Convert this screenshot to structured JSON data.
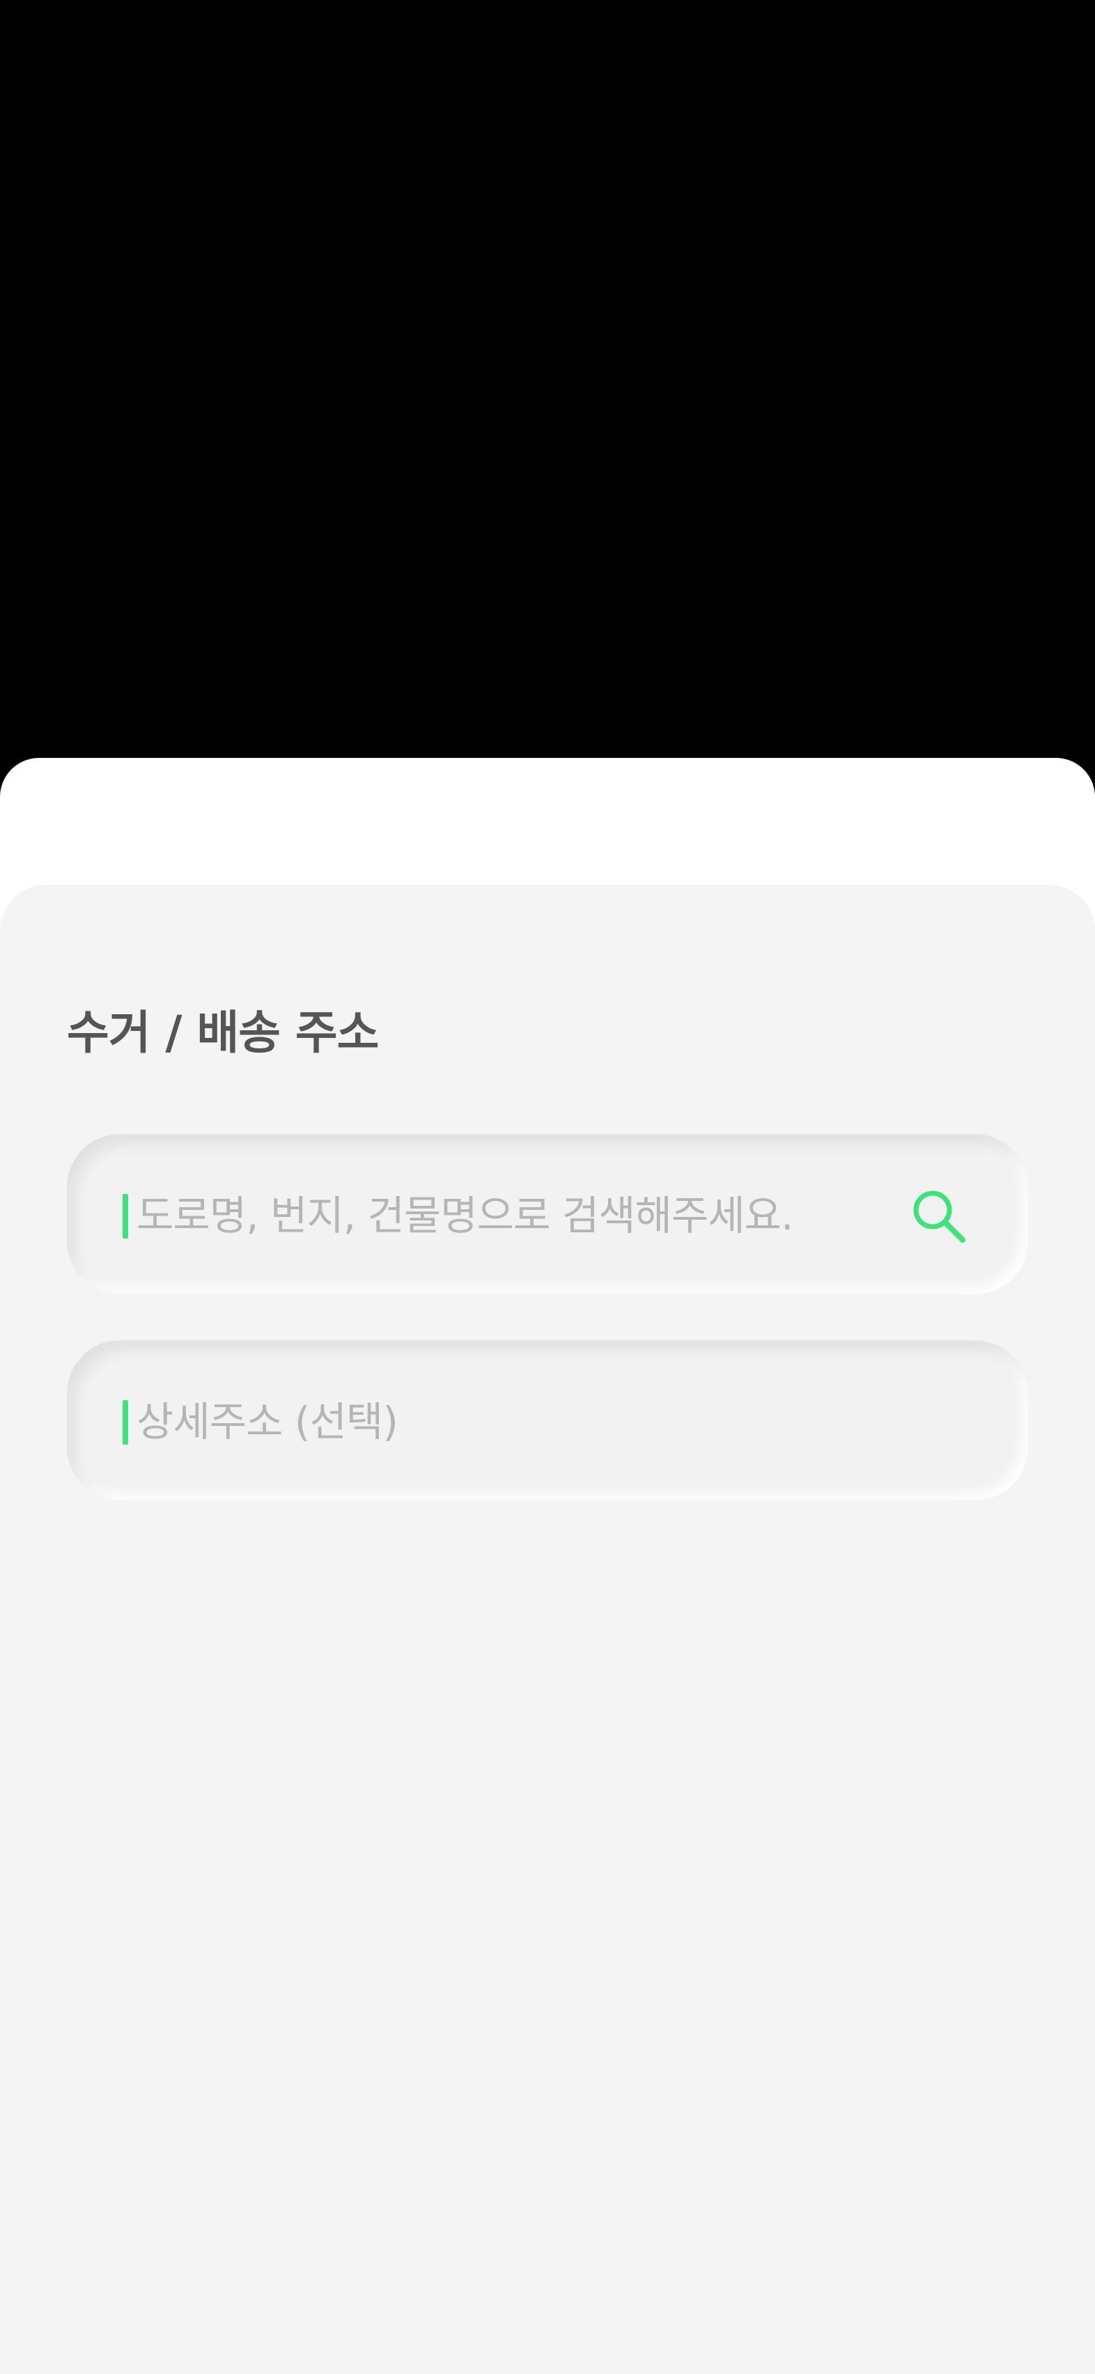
{
  "address_section": {
    "title": "수거 / 배송 주소",
    "search_field": {
      "placeholder": "도로명, 번지, 건물명으로 검색해주세요.",
      "value": "",
      "icon": "search-icon"
    },
    "detail_field": {
      "placeholder": "상세주소 (선택)",
      "value": ""
    }
  },
  "colors": {
    "accent": "#3ee27a",
    "title": "#555555",
    "placeholder": "#b5b5b5",
    "panel_background": "#f4f4f4"
  }
}
